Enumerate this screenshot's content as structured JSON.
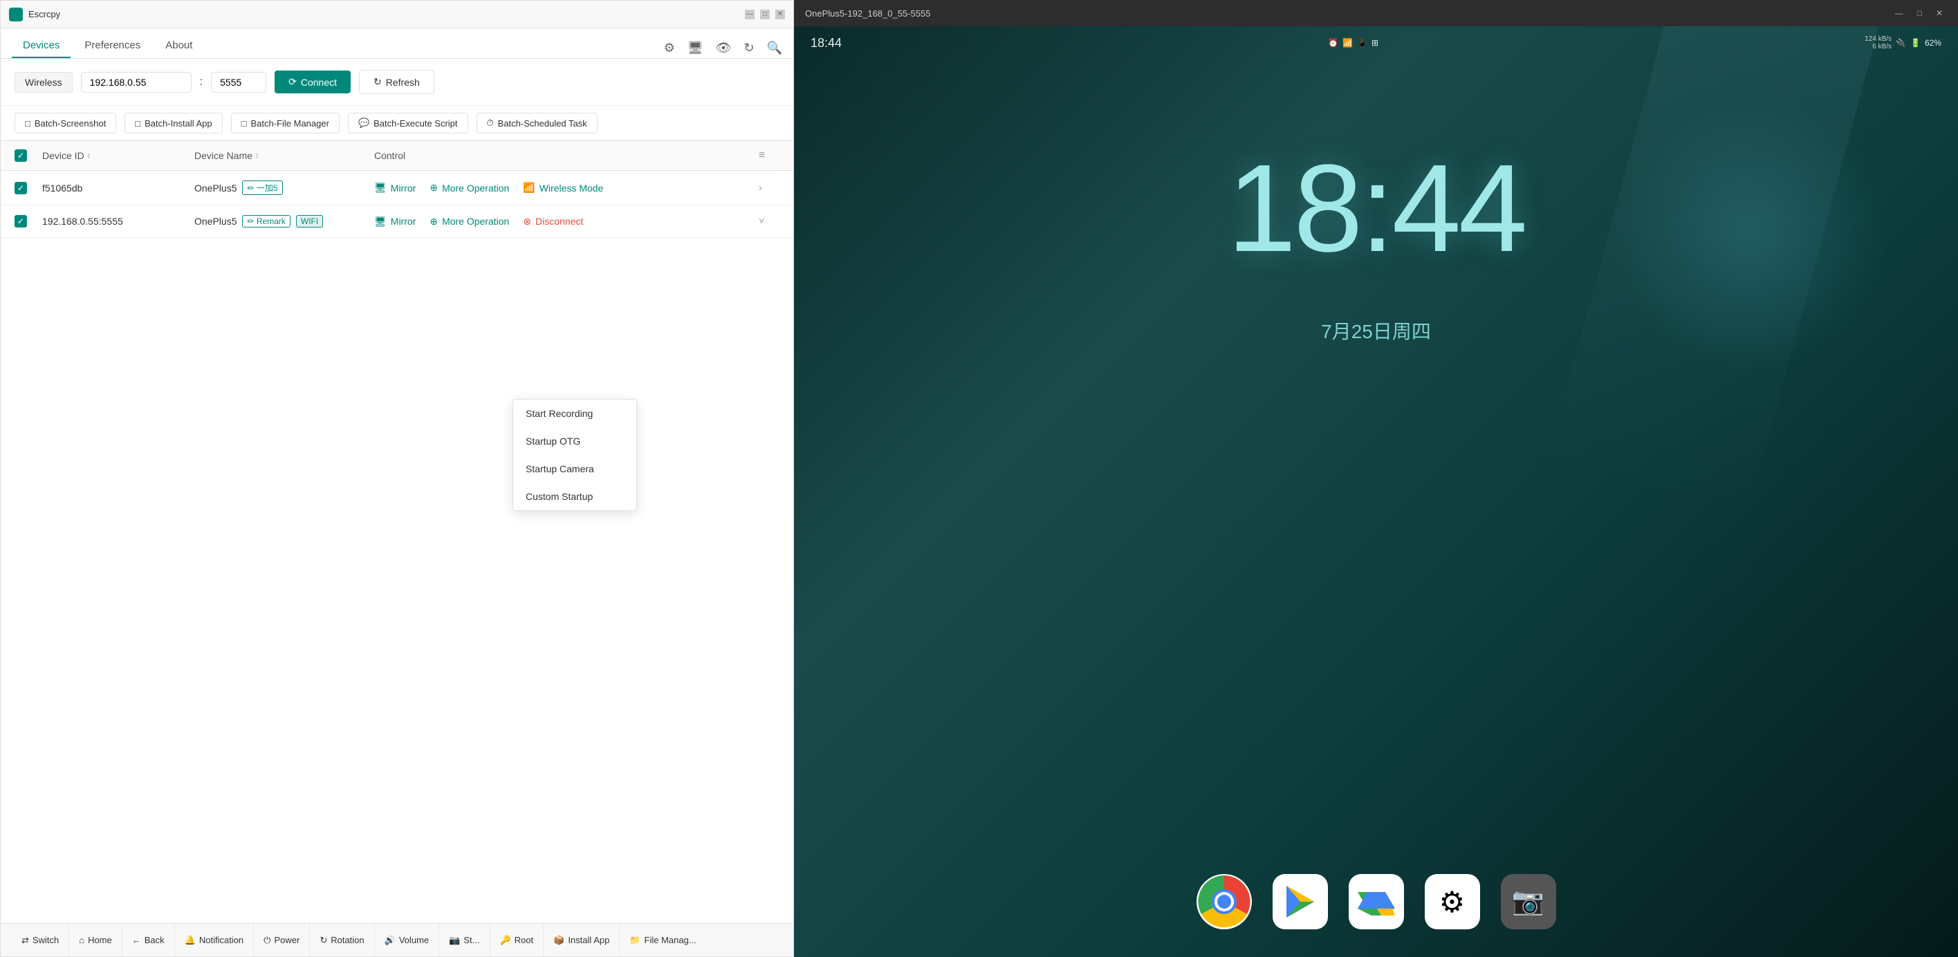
{
  "app": {
    "title": "Escrcpy",
    "logo_color": "#00897b"
  },
  "nav": {
    "tabs": [
      {
        "label": "Devices",
        "active": true
      },
      {
        "label": "Preferences",
        "active": false
      },
      {
        "label": "About",
        "active": false
      }
    ]
  },
  "toolbar_icons": [
    "settings",
    "screen",
    "eye",
    "refresh",
    "search"
  ],
  "connection": {
    "wireless_label": "Wireless",
    "ip_value": "192.168.0.55",
    "port_value": "5555",
    "connect_label": "Connect",
    "refresh_label": "Refresh"
  },
  "batch_ops": [
    {
      "label": "Batch-Screenshot",
      "icon": "📷"
    },
    {
      "label": "Batch-Install App",
      "icon": "📦"
    },
    {
      "label": "Batch-File Manager",
      "icon": "📁"
    },
    {
      "label": "Batch-Execute Script",
      "icon": "💬"
    },
    {
      "label": "Batch-Scheduled Task",
      "icon": "⏱"
    }
  ],
  "table": {
    "headers": [
      {
        "label": "Device ID",
        "sortable": true
      },
      {
        "label": "Device Name",
        "sortable": true
      },
      {
        "label": "Control",
        "sortable": false
      }
    ],
    "rows": [
      {
        "id": "f51065db",
        "name": "OnePlus5",
        "tags": [
          {
            "label": "✏ 一加5"
          }
        ],
        "controls": [
          {
            "label": "Mirror",
            "icon": "🖥"
          },
          {
            "label": "More Operation",
            "icon": "⊕"
          },
          {
            "label": "Wireless Mode",
            "icon": "📶"
          }
        ],
        "expanded": false
      },
      {
        "id": "192.168.0.55:5555",
        "name": "OnePlus5",
        "tags": [
          {
            "label": "✏ Remark"
          },
          {
            "label": "WIFI"
          }
        ],
        "controls": [
          {
            "label": "Mirror",
            "icon": "🖥"
          },
          {
            "label": "More Operation",
            "icon": "⊕"
          },
          {
            "label": "Disconnect",
            "icon": "⊗",
            "danger": true
          }
        ],
        "expanded": true
      }
    ]
  },
  "control_bar": {
    "buttons": [
      {
        "label": "Switch",
        "icon": "⇄"
      },
      {
        "label": "Home",
        "icon": "⌂"
      },
      {
        "label": "Back",
        "icon": "←"
      },
      {
        "label": "Notification",
        "icon": "🔔"
      },
      {
        "label": "Power",
        "icon": "⏻"
      },
      {
        "label": "Rotation",
        "icon": "↻"
      },
      {
        "label": "Volume",
        "icon": "🔊"
      },
      {
        "label": "Screenshot",
        "icon": "📷"
      },
      {
        "label": "Root",
        "icon": "🔑"
      },
      {
        "label": "Install App",
        "icon": "📦"
      },
      {
        "label": "File Manager",
        "icon": "📁"
      }
    ]
  },
  "dropdown": {
    "items": [
      {
        "label": "Start Recording",
        "active": false
      },
      {
        "label": "Startup OTG",
        "active": false
      },
      {
        "label": "Startup Camera",
        "active": false
      },
      {
        "label": "Custom Startup",
        "active": false
      }
    ]
  },
  "phone_panel": {
    "title": "OnePlus5-192_168_0_55-5555",
    "win_controls": [
      "—",
      "□",
      "✕"
    ],
    "status_bar": {
      "time": "18:44",
      "net_speed_up": "124 kB/s",
      "net_speed_down": "6 kB/s",
      "battery": "62%"
    },
    "clock": "18:44",
    "date": "7月25日周四",
    "dock_apps": [
      {
        "name": "Chrome",
        "icon": "chrome"
      },
      {
        "name": "Play Store",
        "icon": "play"
      },
      {
        "name": "Drive",
        "icon": "drive"
      },
      {
        "name": "Settings",
        "icon": "settings"
      },
      {
        "name": "Camera",
        "icon": "camera"
      }
    ]
  }
}
